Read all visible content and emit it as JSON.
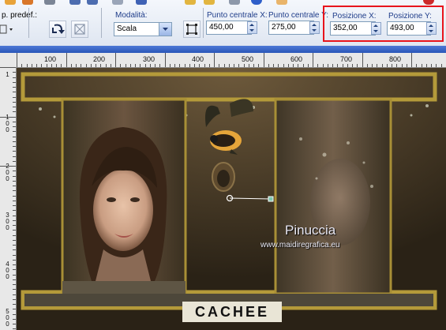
{
  "toolbar": {
    "preset_label": "p. predef.:",
    "mode_label": "Modalità:",
    "mode_value": "Scala",
    "center_x_label": "Punto centrale X:",
    "center_x_value": "450,00",
    "center_y_label": "Punto centrale Y:",
    "center_y_value": "275,00",
    "pos_x_label": "Posizione X:",
    "pos_x_value": "352,00",
    "pos_y_label": "Posizione Y:",
    "pos_y_value": "493,00",
    "highlight_color": "#e8141c"
  },
  "ruler": {
    "h_labels": [
      "100",
      "200",
      "300",
      "400",
      "500",
      "600",
      "700",
      "800"
    ],
    "v_labels": [
      "1",
      "1\n0\n0",
      "2\n0\n0",
      "3\n0\n0",
      "4\n0\n0",
      "5\n0\n0"
    ]
  },
  "canvas": {
    "watermark_name": "Pinuccia",
    "watermark_url": "www.maidiregrafica.eu",
    "badge_text": "CACHEE"
  },
  "colors": {
    "accent": "#1f3d8a",
    "frame_gold": "#b49a3a",
    "title_blue": "#2a56b8"
  }
}
